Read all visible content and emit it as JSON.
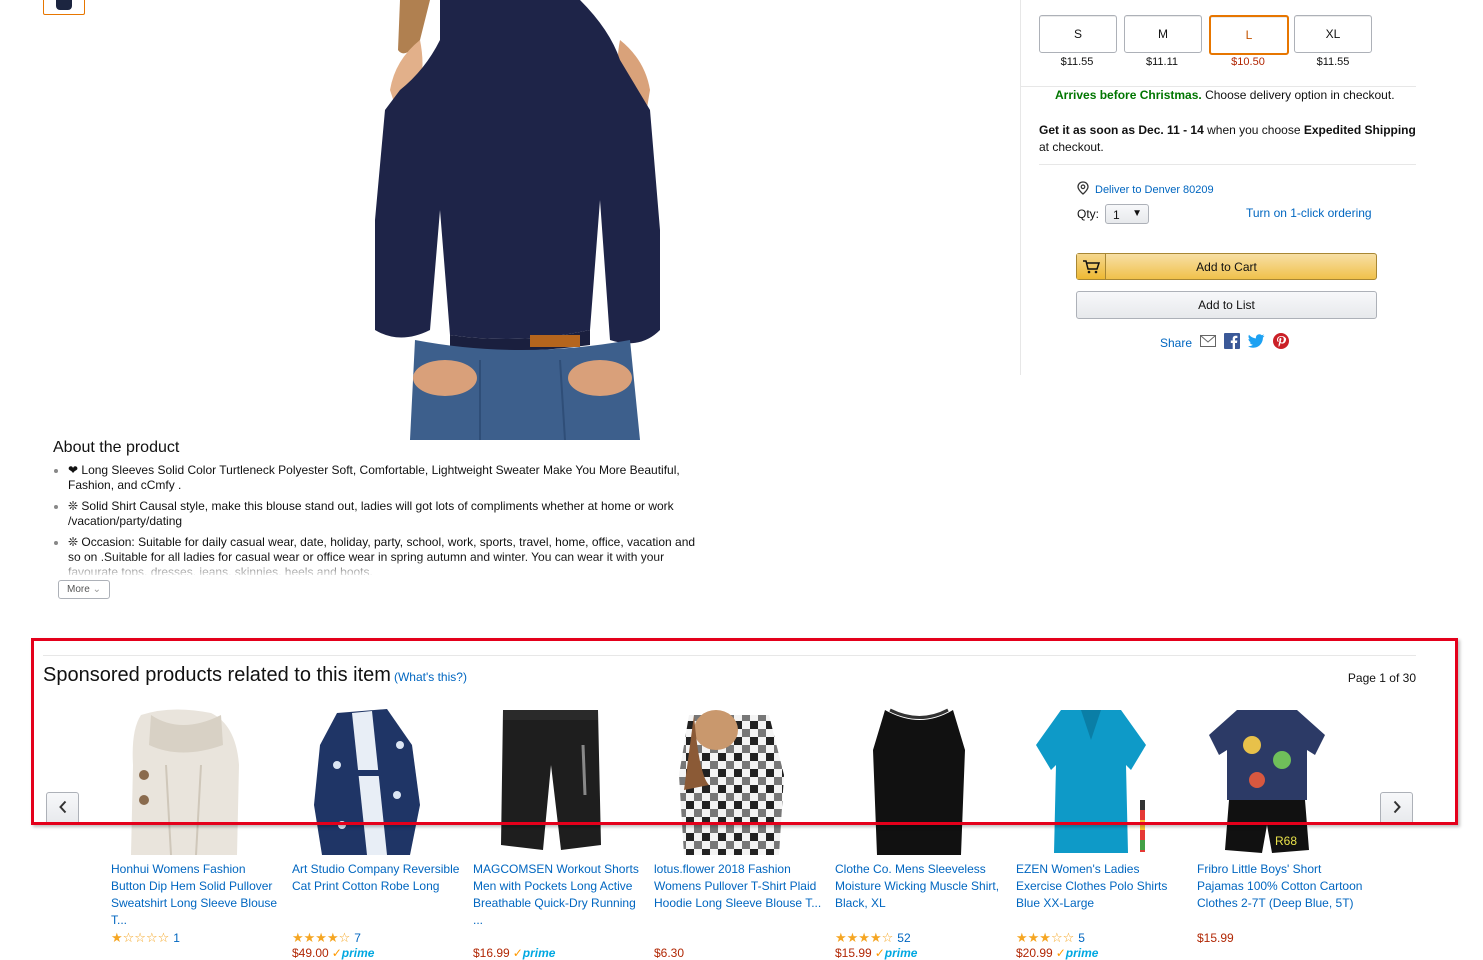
{
  "sizes": [
    {
      "label": "S",
      "price": "$11.55",
      "selected": false
    },
    {
      "label": "M",
      "price": "$11.11",
      "selected": false
    },
    {
      "label": "L",
      "price": "$10.50",
      "selected": true
    },
    {
      "label": "XL",
      "price": "$11.55",
      "selected": false
    }
  ],
  "delivery": {
    "green": "Arrives before Christmas.",
    "rest": "Choose delivery option in checkout.",
    "line2_prefix": "Get it as soon as ",
    "line2_date": "Dec. 11 - 14",
    "line2_mid": " when you choose ",
    "line2_method": "Expedited Shipping",
    "line2_suffix": "at checkout.",
    "location": "Deliver to Denver 80209"
  },
  "qty": {
    "label": "Qty:",
    "value": "1"
  },
  "one_click": "Turn on 1-click ordering",
  "add_to_cart": "Add to Cart",
  "add_to_list": "Add to List",
  "share_label": "Share",
  "about": {
    "title": "About the product",
    "bullets": [
      "❤ Long Sleeves Solid Color Turtleneck Polyester Soft, Comfortable, Lightweight Sweater Make You More Beautiful, Fashion, and cCmfy .",
      "❊ Solid Shirt Causal style, make this blouse stand out, ladies will got lots of compliments whether at home or work /vacation/party/dating",
      "❊ Occasion: Suitable for daily casual wear, date, holiday, party, school, work, sports, travel, home, office, vacation and so on .Suitable for all ladies for casual wear or office wear in spring autumn and winter. You can wear it with your favourate tops, dresses, jeans, skinnies, heels and boots."
    ],
    "more": "More"
  },
  "sponsored": {
    "title": "Sponsored products related to this item",
    "whats_this": "(What's this?)",
    "page_prefix": "Page ",
    "page_current": "1",
    "page_suffix": " of 30",
    "items": [
      {
        "title": "Honhui Womens Fashion Button Dip Hem Solid Pullover Sweatshirt Long Sleeve Blouse T...",
        "rating": 1,
        "reviews": "1",
        "price": "",
        "prime": false,
        "image": "cream-sweater"
      },
      {
        "title": "Art Studio Company Reversible Cat Print Cotton Robe Long",
        "rating": 4.5,
        "reviews": "7",
        "price": "$49.00",
        "prime": true,
        "image": "floral-robe"
      },
      {
        "title": "MAGCOMSEN Workout Shorts Men with Pockets Long Active Breathable Quick-Dry Running ...",
        "rating": 0,
        "reviews": "",
        "price": "$16.99",
        "prime": true,
        "image": "black-shorts"
      },
      {
        "title": "lotus.flower 2018 Fashion Womens Pullover T-Shirt Plaid Hoodie Long Sleeve Blouse T...",
        "rating": 0,
        "reviews": "",
        "price": "$6.30",
        "prime": false,
        "image": "plaid-hoodie"
      },
      {
        "title": "Clothe Co. Mens Sleeveless Moisture Wicking Muscle Shirt, Black, XL",
        "rating": 4.5,
        "reviews": "52",
        "price": "$15.99",
        "prime": true,
        "image": "black-tank"
      },
      {
        "title": "EZEN Women's Ladies Exercise Clothes Polo Shirts Blue XX-Large",
        "rating": 3,
        "reviews": "5",
        "price": "$20.99",
        "prime": true,
        "image": "blue-polo"
      },
      {
        "title": "Fribro Little Boys' Short Pajamas 100% Cotton Cartoon Clothes 2-7T (Deep Blue, 5T)",
        "rating": 0,
        "reviews": "",
        "price": "$15.99",
        "prime": false,
        "image": "kids-pajamas"
      }
    ]
  }
}
